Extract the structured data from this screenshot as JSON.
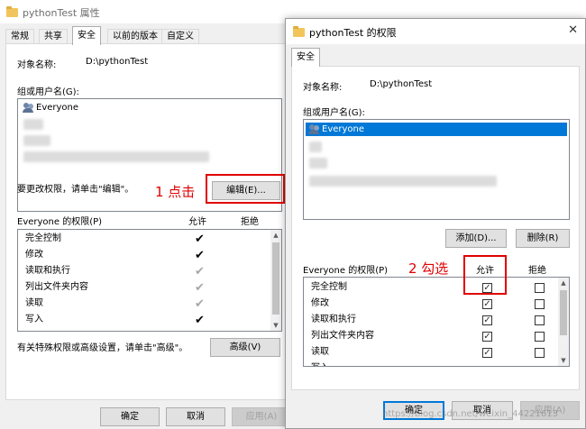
{
  "back_window": {
    "title": "pythonTest 属性",
    "tabs": [
      "常规",
      "共享",
      "安全",
      "以前的版本",
      "自定义"
    ],
    "object_label": "对象名称:",
    "object_value": "D:\\pythonTest",
    "group_label": "组或用户名(G):",
    "users": [
      "Everyone"
    ],
    "change_hint": "要更改权限，请单击\"编辑\"。",
    "edit_button": "编辑(E)...",
    "perm_header": "Everyone 的权限(P)",
    "allow_header": "允许",
    "deny_header": "拒绝",
    "permissions": [
      "完全控制",
      "修改",
      "读取和执行",
      "列出文件夹内容",
      "读取",
      "写入"
    ],
    "allow_states": [
      "dark",
      "dark",
      "gray",
      "gray",
      "gray",
      "dark"
    ],
    "advanced_hint": "有关特殊权限或高级设置，请单击\"高级\"。",
    "advanced_button": "高级(V)",
    "ok_button": "确定",
    "cancel_button": "取消",
    "apply_button": "应用(A)"
  },
  "front_window": {
    "title": "pythonTest 的权限",
    "tab": "安全",
    "object_label": "对象名称:",
    "object_value": "D:\\pythonTest",
    "group_label": "组或用户名(G):",
    "users": [
      "Everyone"
    ],
    "add_button": "添加(D)...",
    "remove_button": "删除(R)",
    "perm_header": "Everyone 的权限(P)",
    "allow_header": "允许",
    "deny_header": "拒绝",
    "permissions": [
      "完全控制",
      "修改",
      "读取和执行",
      "列出文件夹内容",
      "读取",
      "写入"
    ],
    "ok_button": "确定",
    "cancel_button": "取消",
    "apply_button": "应用(A)"
  },
  "annotations": {
    "step1": "1 点击",
    "step2": "2 勾选",
    "accent_color": "#e00000"
  },
  "watermark": "https://blog.csdn.net/weixin_44221613"
}
